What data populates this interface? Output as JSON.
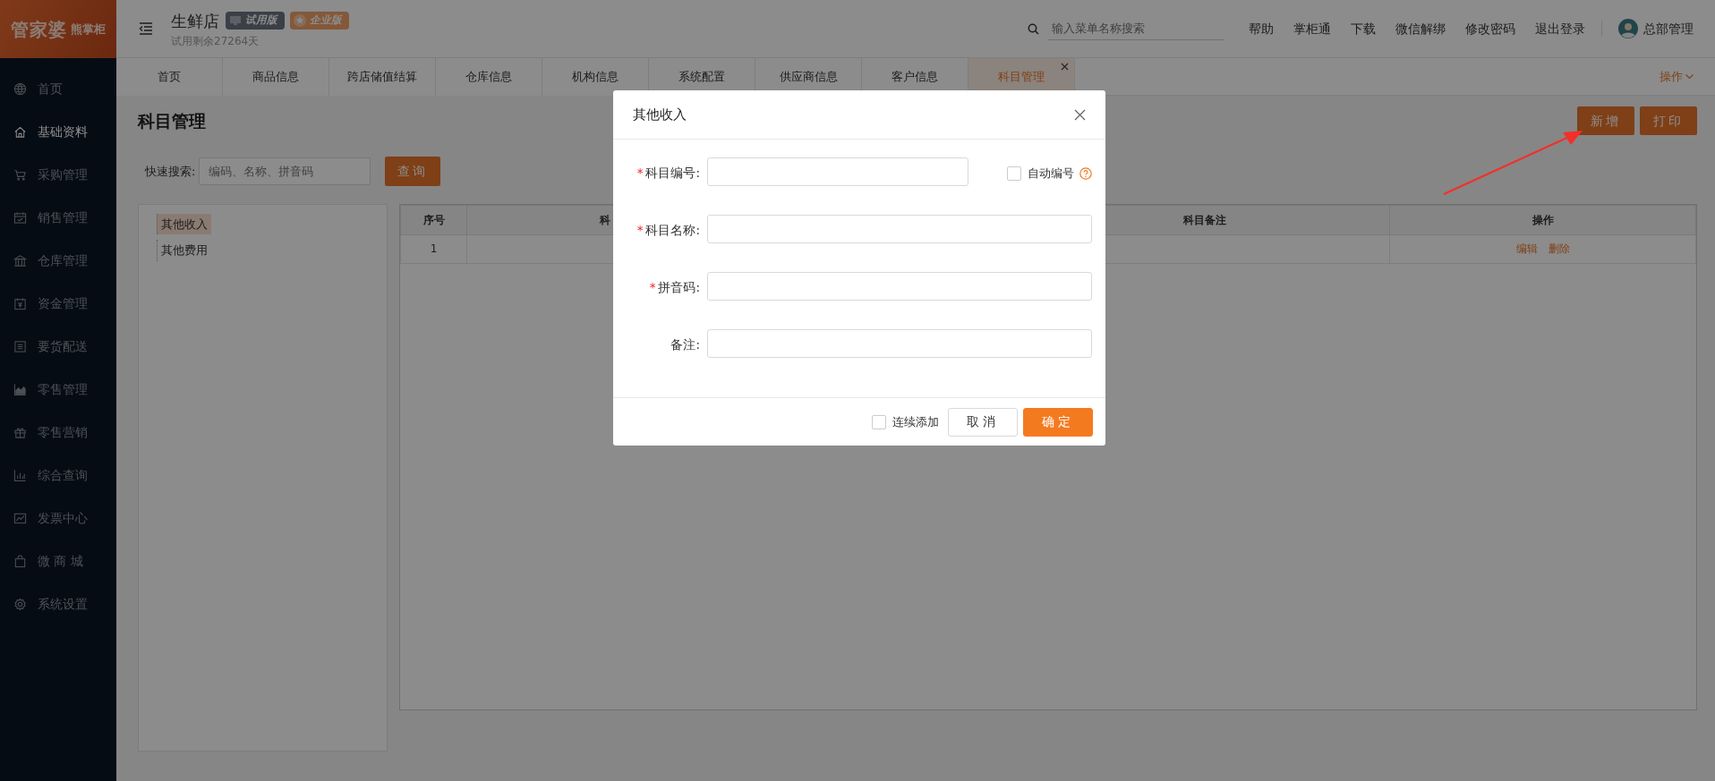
{
  "logo": {
    "main": "管家婆",
    "sub": "熊掌柜"
  },
  "header": {
    "store_name": "生鲜店",
    "badges": [
      {
        "label": "试用版",
        "kind": "trial"
      },
      {
        "label": "企业版",
        "kind": "enterprise"
      }
    ],
    "trial_note": "试用剩余27264天",
    "search": {
      "placeholder": "输入菜单名称搜索"
    },
    "links": [
      "帮助",
      "掌柜通",
      "下载",
      "微信解绑",
      "修改密码",
      "退出登录"
    ],
    "user": "总部管理"
  },
  "tabs": [
    {
      "label": "首页",
      "selected": false,
      "closable": false
    },
    {
      "label": "商品信息",
      "selected": false,
      "closable": false
    },
    {
      "label": "跨店储值结算",
      "selected": false,
      "closable": false
    },
    {
      "label": "仓库信息",
      "selected": false,
      "closable": false
    },
    {
      "label": "机构信息",
      "selected": false,
      "closable": false
    },
    {
      "label": "系统配置",
      "selected": false,
      "closable": false
    },
    {
      "label": "供应商信息",
      "selected": false,
      "closable": false
    },
    {
      "label": "客户信息",
      "selected": false,
      "closable": false
    },
    {
      "label": "科目管理",
      "selected": true,
      "closable": true
    }
  ],
  "tab_actions": "操作",
  "sidebar": {
    "items": [
      {
        "label": "首页",
        "selected": false
      },
      {
        "label": "基础资料",
        "selected": true
      },
      {
        "label": "采购管理",
        "selected": false
      },
      {
        "label": "销售管理",
        "selected": false
      },
      {
        "label": "仓库管理",
        "selected": false
      },
      {
        "label": "资金管理",
        "selected": false
      },
      {
        "label": "要货配送",
        "selected": false
      },
      {
        "label": "零售管理",
        "selected": false
      },
      {
        "label": "零售营销",
        "selected": false
      },
      {
        "label": "综合查询",
        "selected": false
      },
      {
        "label": "发票中心",
        "selected": false
      },
      {
        "label": "微 商 城",
        "selected": false
      },
      {
        "label": "系统设置",
        "selected": false
      }
    ]
  },
  "page": {
    "title": "科目管理",
    "buttons": [
      "新增",
      "打印"
    ],
    "quick_search": {
      "label": "快速搜索:",
      "placeholder": "编码、名称、拼音码",
      "button": "查询"
    },
    "tree": [
      {
        "label": "其他收入",
        "selected": true
      },
      {
        "label": "其他费用",
        "selected": false
      }
    ],
    "table": {
      "columns": [
        {
          "label": "序号"
        },
        {
          "label": "科"
        },
        {
          "label": "科目备注"
        },
        {
          "label": "操作"
        }
      ],
      "rows": [
        {
          "cells": [
            "1"
          ],
          "actions": [
            "编辑",
            "删除"
          ]
        }
      ]
    }
  },
  "modal": {
    "title": "其他收入",
    "fields": [
      {
        "label": "科目编号:",
        "required_mark": "*",
        "auto": {
          "label": "自动编号",
          "checked": false
        }
      },
      {
        "label": "科目名称:",
        "required_mark": "*"
      },
      {
        "label": "拼音码:",
        "required_mark": "*"
      },
      {
        "label": "备注:"
      }
    ],
    "continuous": {
      "label": "连续添加",
      "checked": false
    },
    "buttons": [
      {
        "label": "取消",
        "kind": "default"
      },
      {
        "label": "确定",
        "kind": "primary"
      }
    ]
  }
}
